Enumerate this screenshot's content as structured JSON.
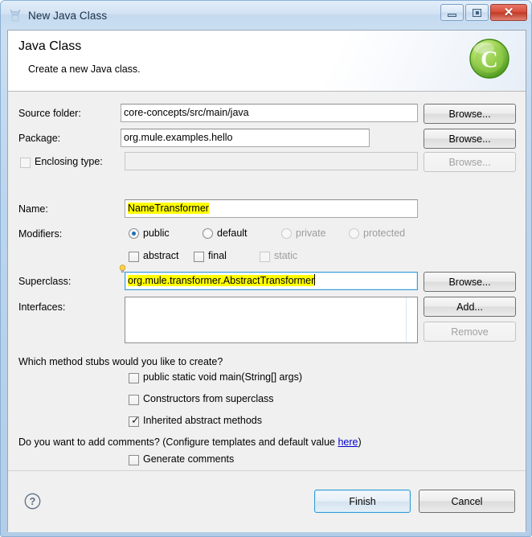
{
  "window": {
    "title": "New Java Class",
    "icon": "java-class-wizard-icon",
    "minimize_label": "Minimize",
    "maximize_label": "Maximize",
    "close_label": "Close"
  },
  "header": {
    "title": "Java Class",
    "subtitle": "Create a new Java class.",
    "badge_icon": "green-c-class-icon",
    "badge_letter": "C"
  },
  "form": {
    "source_folder": {
      "label": "Source folder:",
      "value": "core-concepts/src/main/java",
      "browse_label": "Browse..."
    },
    "package": {
      "label": "Package:",
      "value": "org.mule.examples.hello",
      "browse_label": "Browse..."
    },
    "enclosing_type": {
      "label": "Enclosing type:",
      "value": "",
      "checked": false,
      "enabled": false,
      "browse_label": "Browse..."
    },
    "name": {
      "label": "Name:",
      "value": "NameTransformer",
      "highlighted": true
    },
    "modifiers": {
      "label": "Modifiers:",
      "access": [
        {
          "label": "public",
          "selected": true,
          "enabled": true
        },
        {
          "label": "default",
          "selected": false,
          "enabled": true
        },
        {
          "label": "private",
          "selected": false,
          "enabled": false
        },
        {
          "label": "protected",
          "selected": false,
          "enabled": false
        }
      ],
      "flags": [
        {
          "label": "abstract",
          "checked": false,
          "enabled": true
        },
        {
          "label": "final",
          "checked": false,
          "enabled": true
        },
        {
          "label": "static",
          "checked": false,
          "enabled": false
        }
      ]
    },
    "superclass": {
      "label": "Superclass:",
      "value": "org.mule.transformer.AbstractTransformer",
      "highlighted": true,
      "focused": true,
      "hint_icon": "lightbulb-icon",
      "browse_label": "Browse..."
    },
    "interfaces": {
      "label": "Interfaces:",
      "items": [],
      "add_label": "Add...",
      "remove_label": "Remove",
      "remove_enabled": false
    }
  },
  "stubs": {
    "question": "Which method stubs would you like to create?",
    "options": [
      {
        "label": "public static void main(String[] args)",
        "checked": false
      },
      {
        "label": "Constructors from superclass",
        "checked": false
      },
      {
        "label": "Inherited abstract methods",
        "checked": true
      }
    ]
  },
  "comments": {
    "question_prefix": "Do you want to add comments? (Configure templates and default value ",
    "link": "here",
    "question_suffix": ")",
    "option": {
      "label": "Generate comments",
      "checked": false
    }
  },
  "footer": {
    "help_icon": "help-question-icon",
    "finish_label": "Finish",
    "cancel_label": "Cancel"
  },
  "colors": {
    "highlight": "#ffff00",
    "link": "#0000cc",
    "accent": "#2f9bd4",
    "badge_green": "#7ac943"
  }
}
